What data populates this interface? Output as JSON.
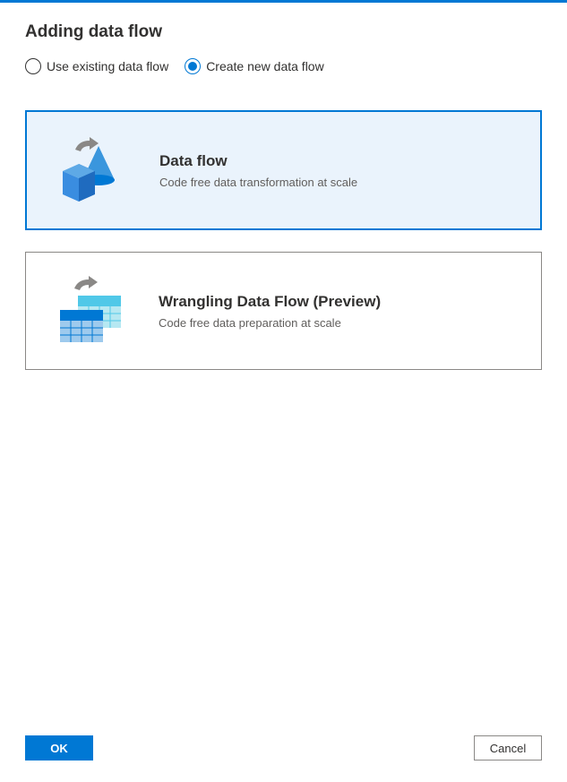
{
  "header": {
    "title": "Adding data flow"
  },
  "radios": {
    "existing": {
      "label": "Use existing data flow",
      "selected": false
    },
    "create": {
      "label": "Create new data flow",
      "selected": true
    }
  },
  "cards": {
    "dataflow": {
      "title": "Data flow",
      "description": "Code free data transformation at scale",
      "selected": true
    },
    "wrangling": {
      "title": "Wrangling Data Flow (Preview)",
      "description": "Code free data preparation at scale",
      "selected": false
    }
  },
  "footer": {
    "ok": "OK",
    "cancel": "Cancel"
  },
  "colors": {
    "primary": "#0078d4"
  }
}
